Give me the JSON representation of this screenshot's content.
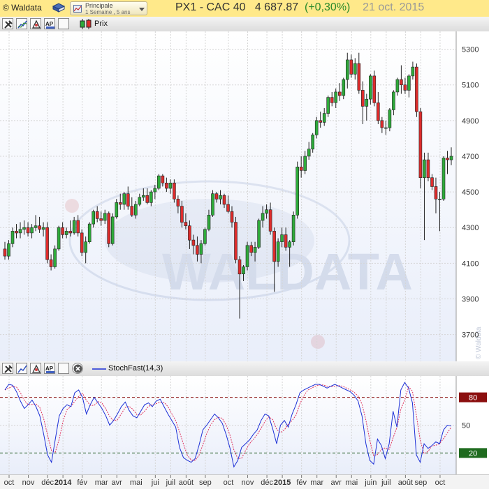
{
  "app": {
    "brand": "© Waldata",
    "combo_line1": "Principale",
    "combo_line2": "1 Semaine , 5 ans",
    "instrument": "PX1 - CAC 40",
    "price": "4 687.87",
    "change": "(+0,30%)",
    "date": "21 oct. 2015",
    "price_legend": "Prix",
    "stoch_legend": "StochFast(14,3)",
    "watermark": "WALDATA",
    "side_watermark": "© Waldata"
  },
  "colors": {
    "title_bg": "#ffe98a",
    "up": "#2eaa3a",
    "down": "#dd2c2c",
    "stoch_main": "#1c2fd6",
    "stoch_signal": "#e0305c",
    "level_line": "#8b1010",
    "level_80_bg": "#8b0f0f",
    "level_20_bg": "#1f6b1f",
    "grid": "#d5d5d5"
  },
  "chart_data": [
    {
      "type": "candlestick",
      "title": "PX1 - CAC 40",
      "ylim": [
        3550,
        5400
      ],
      "y_ticks": [
        3700,
        3900,
        4100,
        4300,
        4500,
        4700,
        4900,
        5100,
        5300
      ],
      "x_labels": [
        "oct",
        "nov",
        "déc",
        "2014",
        "fév",
        "mar",
        "avr",
        "mai",
        "jui",
        "juil",
        "août",
        "sep",
        "oct",
        "nov",
        "déc",
        "2015",
        "fév",
        "mar",
        "avr",
        "mai",
        "juin",
        "juil",
        "août",
        "sep",
        "oct"
      ],
      "grid": true,
      "ohlc": [
        [
          4180,
          4220,
          4120,
          4140
        ],
        [
          4140,
          4230,
          4120,
          4210
        ],
        [
          4210,
          4300,
          4190,
          4280
        ],
        [
          4280,
          4320,
          4240,
          4270
        ],
        [
          4270,
          4330,
          4240,
          4290
        ],
        [
          4290,
          4340,
          4260,
          4300
        ],
        [
          4300,
          4330,
          4250,
          4270
        ],
        [
          4270,
          4320,
          4240,
          4300
        ],
        [
          4300,
          4370,
          4280,
          4310
        ],
        [
          4310,
          4360,
          4270,
          4290
        ],
        [
          4290,
          4330,
          4250,
          4300
        ],
        [
          4300,
          4330,
          4100,
          4120
        ],
        [
          4120,
          4150,
          4060,
          4080
        ],
        [
          4080,
          4200,
          4070,
          4180
        ],
        [
          4180,
          4310,
          4170,
          4300
        ],
        [
          4300,
          4330,
          4240,
          4260
        ],
        [
          4260,
          4300,
          4240,
          4280
        ],
        [
          4280,
          4340,
          4250,
          4270
        ],
        [
          4270,
          4360,
          4260,
          4340
        ],
        [
          4340,
          4370,
          4250,
          4270
        ],
        [
          4270,
          4290,
          4140,
          4160
        ],
        [
          4160,
          4250,
          4100,
          4220
        ],
        [
          4220,
          4330,
          4210,
          4320
        ],
        [
          4320,
          4400,
          4300,
          4390
        ],
        [
          4390,
          4420,
          4330,
          4350
        ],
        [
          4350,
          4390,
          4310,
          4340
        ],
        [
          4340,
          4400,
          4320,
          4380
        ],
        [
          4380,
          4390,
          4190,
          4210
        ],
        [
          4210,
          4380,
          4200,
          4360
        ],
        [
          4360,
          4460,
          4350,
          4440
        ],
        [
          4440,
          4490,
          4400,
          4430
        ],
        [
          4430,
          4500,
          4400,
          4490
        ],
        [
          4490,
          4530,
          4400,
          4420
        ],
        [
          4420,
          4470,
          4360,
          4370
        ],
        [
          4370,
          4450,
          4350,
          4430
        ],
        [
          4430,
          4490,
          4420,
          4470
        ],
        [
          4470,
          4520,
          4450,
          4480
        ],
        [
          4480,
          4520,
          4430,
          4440
        ],
        [
          4440,
          4510,
          4420,
          4500
        ],
        [
          4500,
          4540,
          4460,
          4520
        ],
        [
          4520,
          4600,
          4510,
          4590
        ],
        [
          4590,
          4600,
          4530,
          4550
        ],
        [
          4550,
          4580,
          4500,
          4520
        ],
        [
          4520,
          4570,
          4490,
          4550
        ],
        [
          4550,
          4570,
          4440,
          4460
        ],
        [
          4460,
          4480,
          4380,
          4420
        ],
        [
          4420,
          4450,
          4300,
          4330
        ],
        [
          4330,
          4380,
          4290,
          4310
        ],
        [
          4310,
          4340,
          4180,
          4230
        ],
        [
          4230,
          4260,
          4150,
          4200
        ],
        [
          4200,
          4250,
          4110,
          4150
        ],
        [
          4150,
          4230,
          4100,
          4210
        ],
        [
          4210,
          4300,
          4200,
          4290
        ],
        [
          4290,
          4400,
          4280,
          4370
        ],
        [
          4370,
          4510,
          4360,
          4490
        ],
        [
          4490,
          4500,
          4440,
          4460
        ],
        [
          4460,
          4510,
          4430,
          4480
        ],
        [
          4480,
          4490,
          4410,
          4430
        ],
        [
          4430,
          4480,
          4380,
          4390
        ],
        [
          4390,
          4420,
          4300,
          4330
        ],
        [
          4330,
          4360,
          4100,
          4120
        ],
        [
          4120,
          4140,
          3790,
          4040
        ],
        [
          4040,
          4090,
          4000,
          4080
        ],
        [
          4080,
          4220,
          4060,
          4200
        ],
        [
          4200,
          4220,
          4140,
          4160
        ],
        [
          4160,
          4220,
          4110,
          4190
        ],
        [
          4190,
          4350,
          4180,
          4340
        ],
        [
          4340,
          4420,
          4300,
          4380
        ],
        [
          4380,
          4430,
          4350,
          4400
        ],
        [
          4400,
          4440,
          4260,
          4280
        ],
        [
          4280,
          4300,
          3940,
          4110
        ],
        [
          4110,
          4240,
          4080,
          4220
        ],
        [
          4220,
          4300,
          4190,
          4260
        ],
        [
          4260,
          4300,
          4170,
          4190
        ],
        [
          4190,
          4230,
          4080,
          4220
        ],
        [
          4220,
          4390,
          4200,
          4370
        ],
        [
          4370,
          4670,
          4350,
          4640
        ],
        [
          4640,
          4700,
          4580,
          4620
        ],
        [
          4620,
          4730,
          4600,
          4700
        ],
        [
          4700,
          4780,
          4680,
          4740
        ],
        [
          4740,
          4830,
          4720,
          4820
        ],
        [
          4820,
          4920,
          4800,
          4900
        ],
        [
          4900,
          4950,
          4860,
          4890
        ],
        [
          4890,
          4970,
          4870,
          4940
        ],
        [
          4940,
          5040,
          4920,
          5030
        ],
        [
          5030,
          5060,
          4980,
          5000
        ],
        [
          5000,
          5080,
          4970,
          5060
        ],
        [
          5060,
          5110,
          5010,
          5040
        ],
        [
          5040,
          5140,
          5020,
          5130
        ],
        [
          5130,
          5280,
          5080,
          5240
        ],
        [
          5240,
          5270,
          5140,
          5160
        ],
        [
          5160,
          5250,
          5130,
          5220
        ],
        [
          5220,
          5280,
          5050,
          5070
        ],
        [
          5070,
          5120,
          4880,
          4980
        ],
        [
          4980,
          5050,
          4900,
          5020
        ],
        [
          5020,
          5160,
          4990,
          5150
        ],
        [
          5150,
          5180,
          4980,
          5000
        ],
        [
          5000,
          5060,
          4880,
          4900
        ],
        [
          4900,
          4920,
          4830,
          4860
        ],
        [
          4860,
          4900,
          4820,
          4860
        ],
        [
          4860,
          4970,
          4840,
          4960
        ],
        [
          4960,
          5070,
          4930,
          5060
        ],
        [
          5060,
          5140,
          5040,
          5130
        ],
        [
          5130,
          5210,
          5050,
          5100
        ],
        [
          5100,
          5140,
          5050,
          5070
        ],
        [
          5070,
          5160,
          5030,
          5150
        ],
        [
          5150,
          5230,
          5130,
          5200
        ],
        [
          5200,
          5220,
          4920,
          4950
        ],
        [
          4950,
          4970,
          4520,
          4580
        ],
        [
          4580,
          4720,
          4230,
          4680
        ],
        [
          4680,
          4720,
          4560,
          4580
        ],
        [
          4580,
          4600,
          4510,
          4530
        ],
        [
          4530,
          4580,
          4380,
          4460
        ],
        [
          4460,
          4500,
          4280,
          4460
        ],
        [
          4460,
          4700,
          4450,
          4690
        ],
        [
          4690,
          4730,
          4600,
          4680
        ],
        [
          4680,
          4750,
          4650,
          4700
        ]
      ]
    },
    {
      "type": "line",
      "title": "StochFast(14,3)",
      "ylim": [
        0,
        100
      ],
      "levels": [
        80,
        20
      ],
      "y_ticks": [
        20,
        50,
        80
      ],
      "series": [
        {
          "name": "StochFast(14,3)",
          "values": [
            88,
            94,
            93,
            86,
            76,
            68,
            72,
            77,
            70,
            60,
            40,
            18,
            10,
            35,
            60,
            68,
            72,
            70,
            85,
            88,
            80,
            62,
            72,
            80,
            74,
            68,
            60,
            50,
            55,
            62,
            70,
            75,
            66,
            60,
            58,
            65,
            72,
            74,
            70,
            76,
            78,
            70,
            62,
            55,
            48,
            26,
            15,
            12,
            10,
            14,
            28,
            45,
            50,
            56,
            62,
            58,
            52,
            40,
            25,
            5,
            12,
            26,
            30,
            34,
            40,
            45,
            55,
            62,
            60,
            46,
            30,
            50,
            55,
            48,
            62,
            72,
            85,
            88,
            90,
            92,
            94,
            94,
            92,
            90,
            92,
            94,
            92,
            90,
            88,
            86,
            82,
            76,
            60,
            30,
            12,
            8,
            35,
            28,
            14,
            30,
            65,
            48,
            88,
            96,
            90,
            74,
            18,
            10,
            30,
            25,
            28,
            32,
            30,
            45,
            50,
            49
          ],
          "style": "solid"
        }
      ]
    }
  ]
}
